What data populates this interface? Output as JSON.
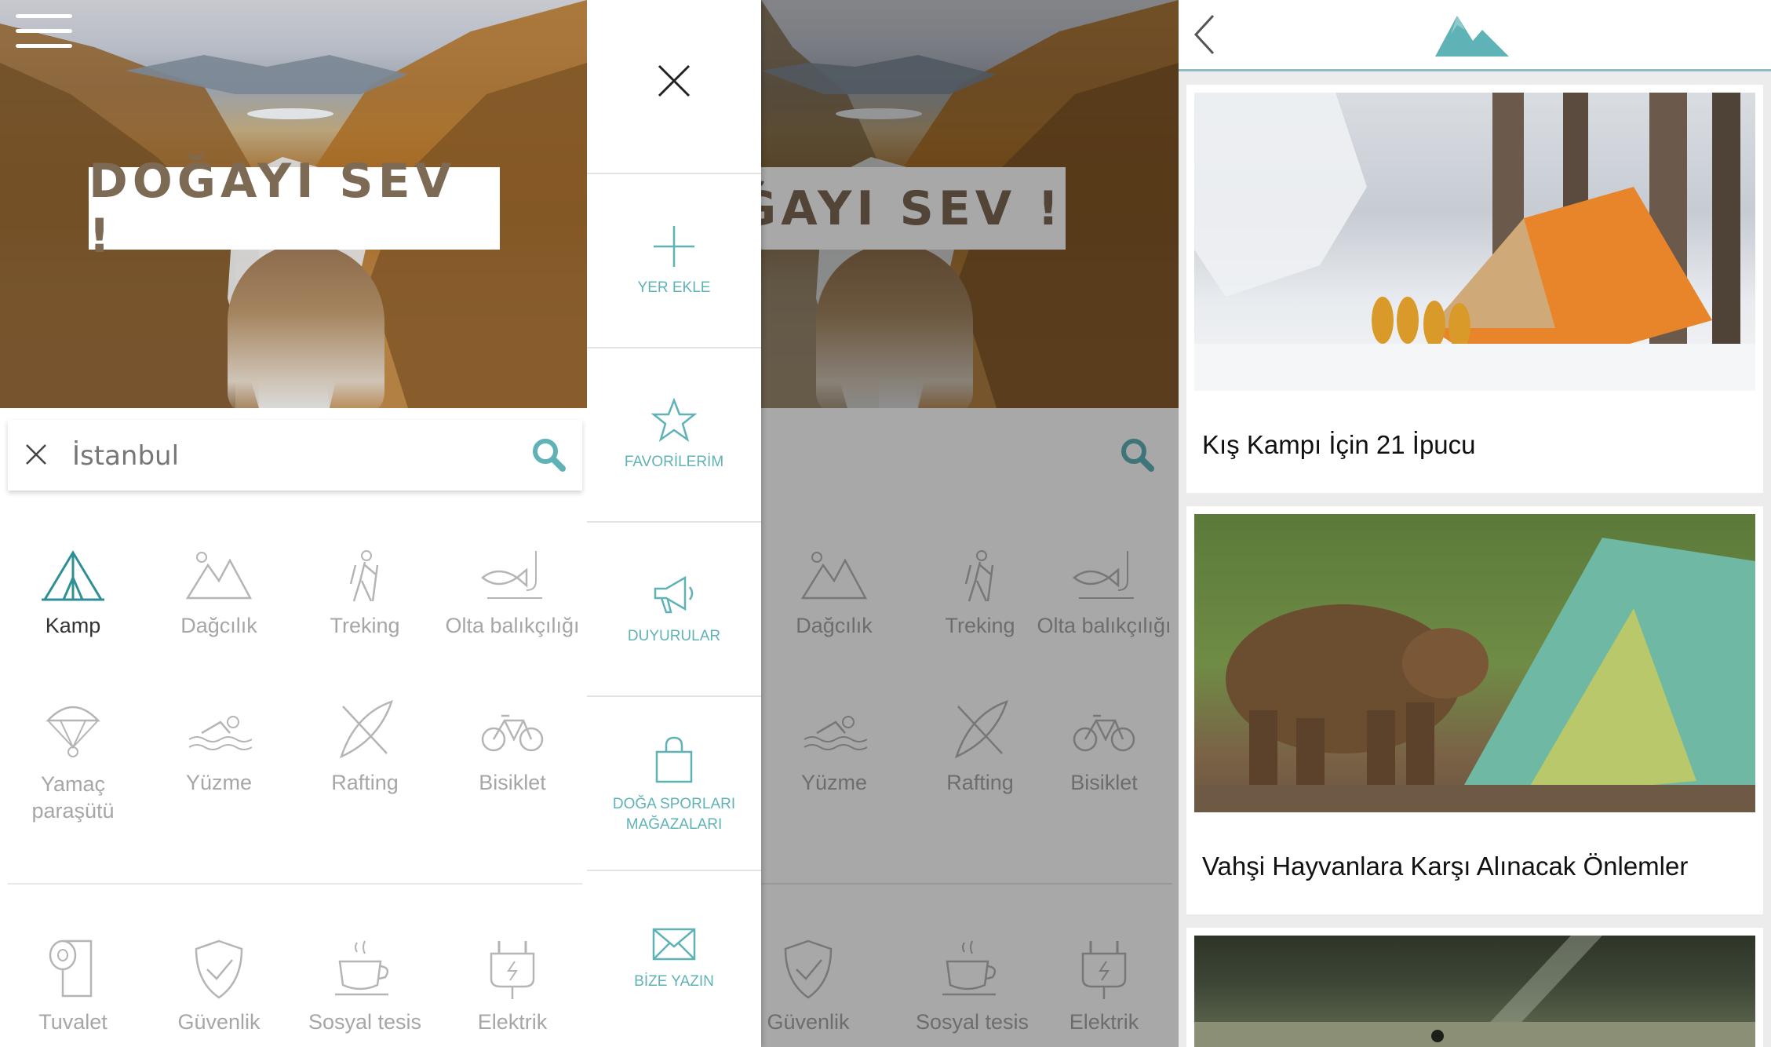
{
  "screen_home": {
    "hero_banner": "DOĞAYI SEV !",
    "search_placeholder": "İstanbul",
    "categories": [
      {
        "label": "Kamp",
        "icon": "tent-icon",
        "active": true
      },
      {
        "label": "Dağcılık",
        "icon": "mountains-icon",
        "active": false
      },
      {
        "label": "Treking",
        "icon": "hiker-icon",
        "active": false
      },
      {
        "label": "Olta balıkçılığı",
        "icon": "fishing-icon",
        "active": false
      },
      {
        "label": "Yamaç paraşütü",
        "icon": "paraglider-icon",
        "active": false
      },
      {
        "label": "Yüzme",
        "icon": "swimmer-icon",
        "active": false
      },
      {
        "label": "Rafting",
        "icon": "kayak-icon",
        "active": false
      },
      {
        "label": "Bisiklet",
        "icon": "bicycle-icon",
        "active": false
      }
    ],
    "facilities": [
      {
        "label": "Tuvalet",
        "icon": "toilet-paper-icon"
      },
      {
        "label": "Güvenlik",
        "icon": "shield-check-icon"
      },
      {
        "label": "Sosyal tesis",
        "icon": "coffee-cup-icon"
      },
      {
        "label": "Elektrik",
        "icon": "power-plug-icon"
      }
    ]
  },
  "screen_menu": {
    "hero_banner": "ĞAYI SEV !",
    "drawer_items": [
      {
        "label": "YER EKLE",
        "icon": "plus-icon"
      },
      {
        "label": "FAVORİLERİM",
        "icon": "star-icon"
      },
      {
        "label": "DUYURULAR",
        "icon": "megaphone-icon"
      },
      {
        "label": "DOĞA SPORLARI MAĞAZALARI",
        "icon": "shopping-bag-icon"
      },
      {
        "label": "BİZE YAZIN",
        "icon": "envelope-icon"
      }
    ],
    "categories": [
      {
        "label": "Dağcılık",
        "icon": "mountains-icon"
      },
      {
        "label": "Treking",
        "icon": "hiker-icon"
      },
      {
        "label": "Olta balıkçılığı",
        "icon": "fishing-icon"
      },
      {
        "label": "Yüzme",
        "icon": "swimmer-icon"
      },
      {
        "label": "Rafting",
        "icon": "kayak-icon"
      },
      {
        "label": "Bisiklet",
        "icon": "bicycle-icon"
      }
    ],
    "facilities": [
      {
        "label": "Güvenlik",
        "icon": "shield-check-icon"
      },
      {
        "label": "Sosyal tesis",
        "icon": "coffee-cup-icon"
      },
      {
        "label": "Elektrik",
        "icon": "power-plug-icon"
      }
    ]
  },
  "screen_articles": {
    "logo_icon": "mountain-logo-icon",
    "articles": [
      {
        "title": "Kış Kampı İçin 21 İpucu"
      },
      {
        "title": "Vahşi Hayvanlara Karşı Alınacak Önlemler"
      }
    ]
  },
  "colors": {
    "accent": "#5fb2b6",
    "inactive_text": "#a6a6a6",
    "active_text": "#333333"
  }
}
